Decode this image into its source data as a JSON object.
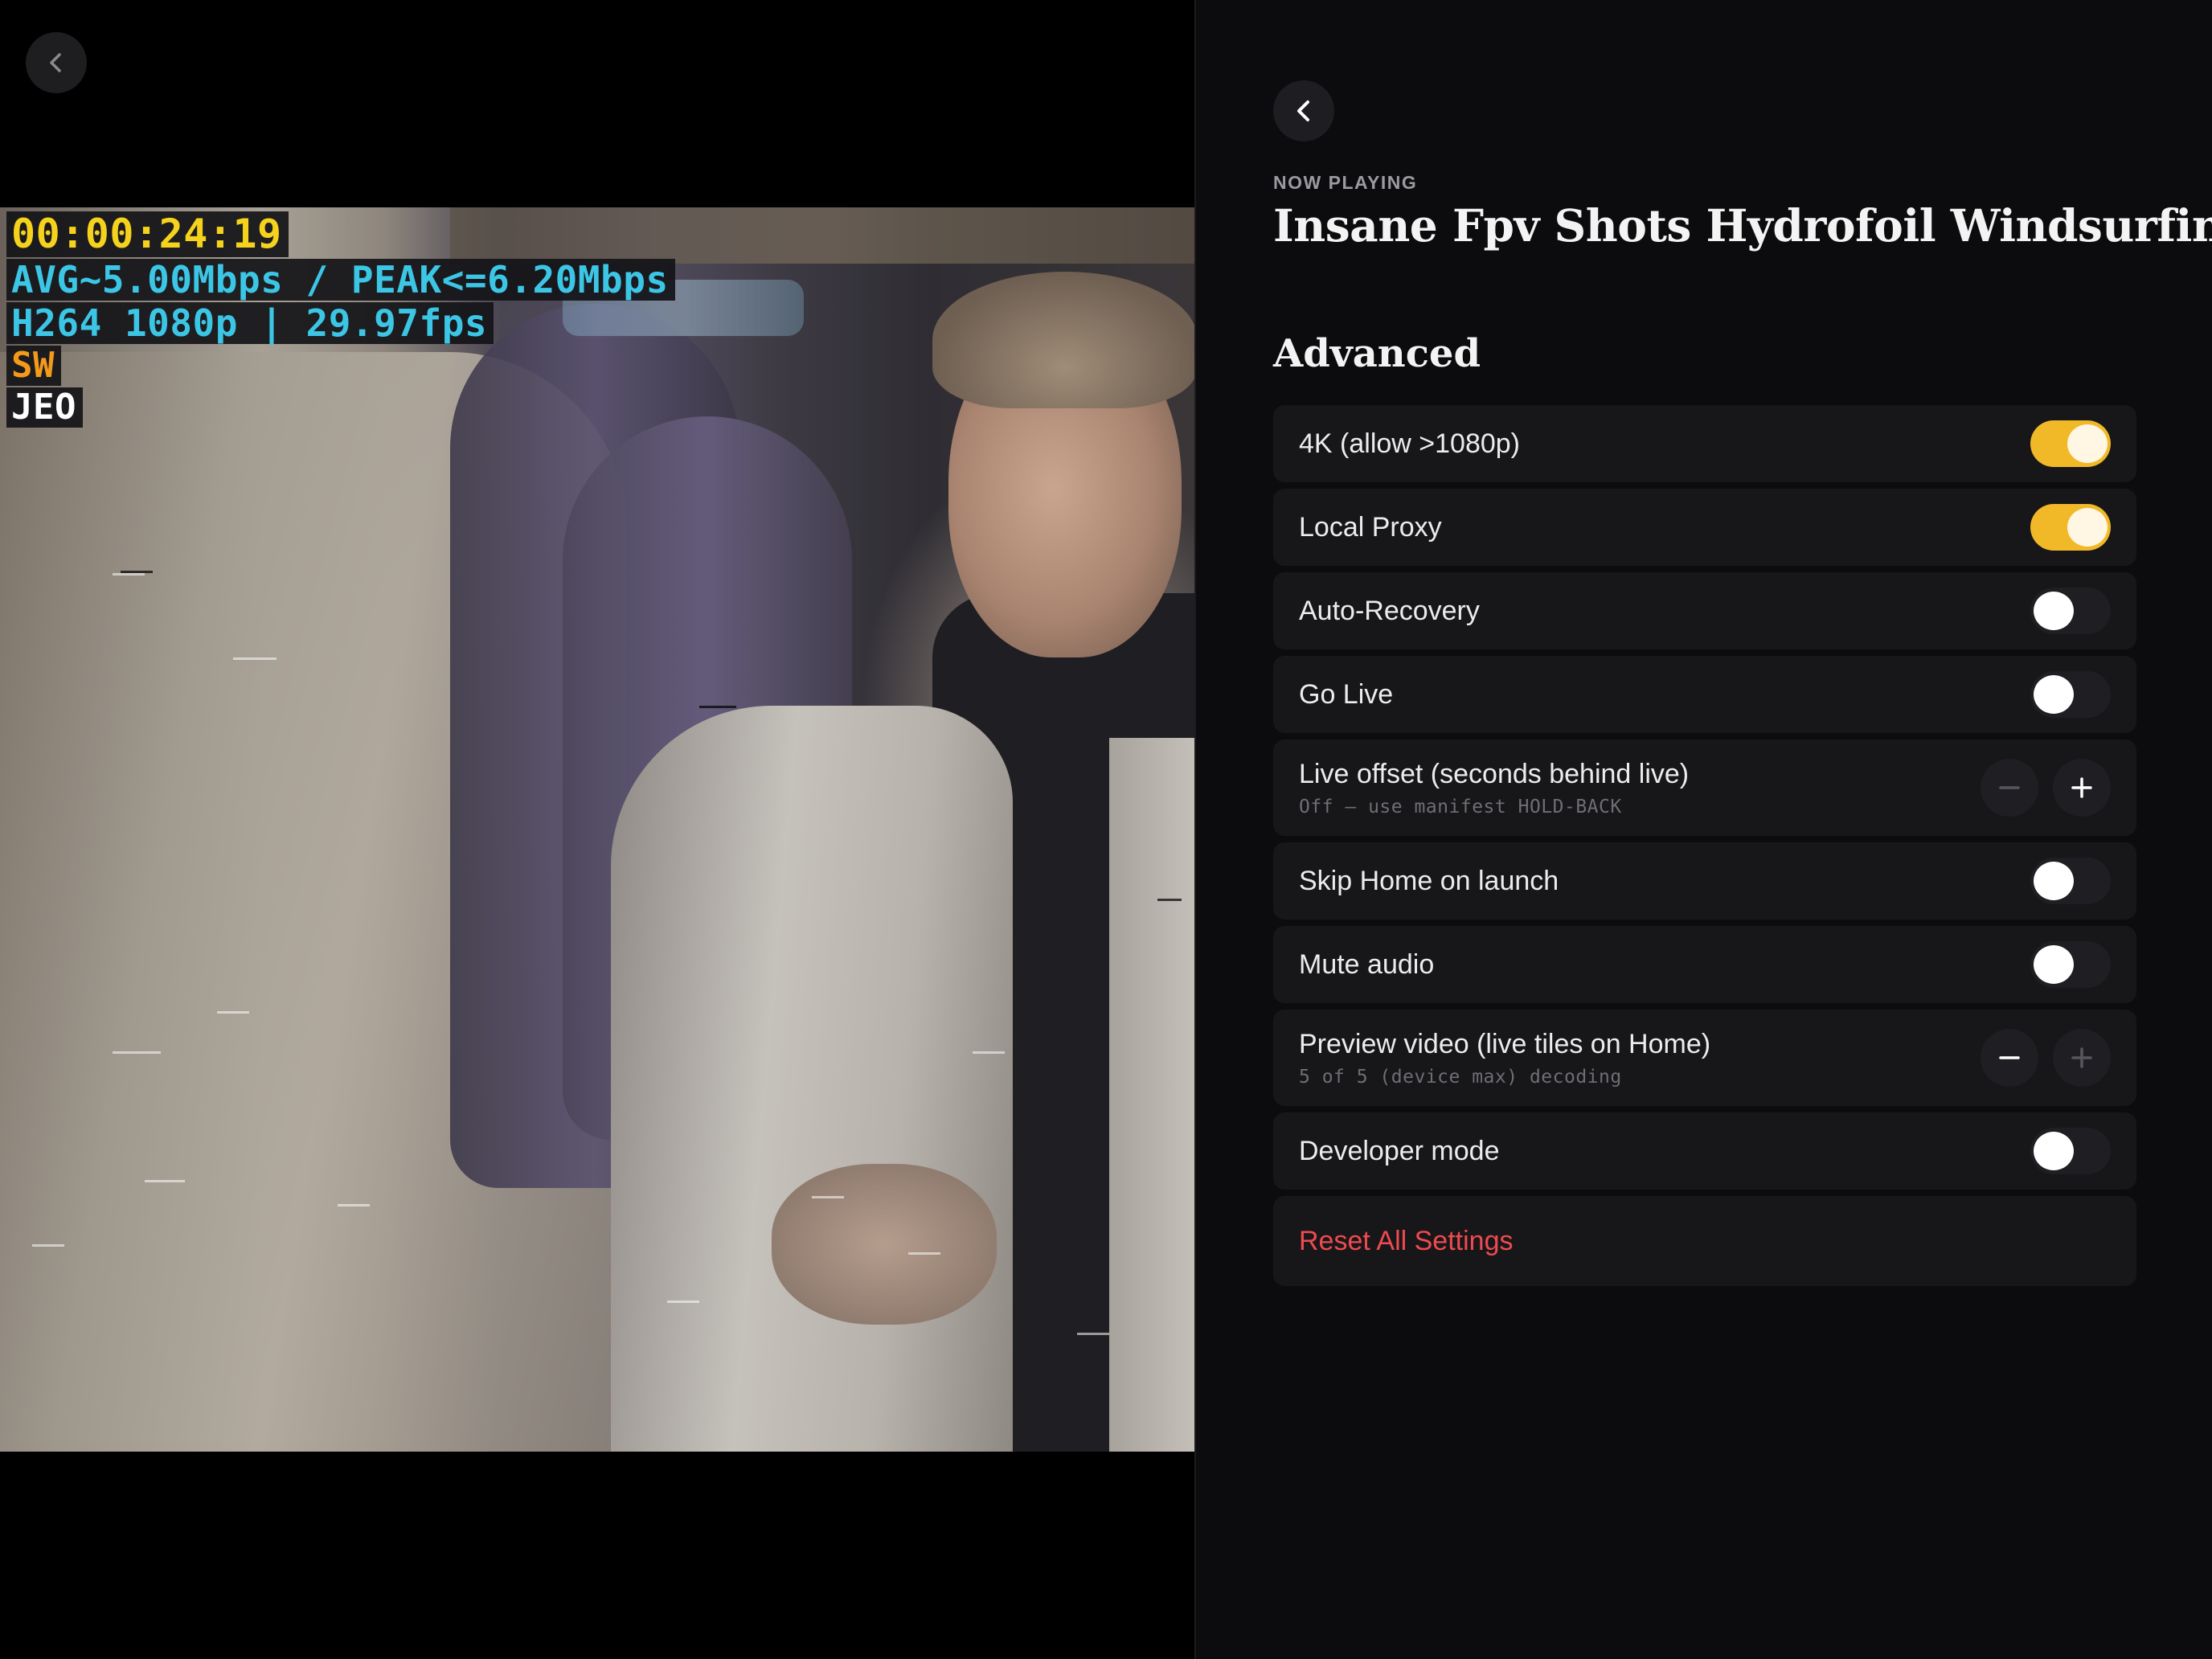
{
  "video": {
    "osd": {
      "timecode": "00:00:24:19",
      "bitrate": "AVG~5.00Mbps / PEAK<=6.20Mbps",
      "codec": "H264 1080p | 29.97fps",
      "decoder": "SW",
      "player": "JEO"
    },
    "osd_colors": {
      "timecode": "#f5d21c",
      "bitrate": "#3cc6e6",
      "codec": "#3cc6e6",
      "decoder": "#f39a1a",
      "player": "#ffffff"
    },
    "back_icon": "chevron-left-icon"
  },
  "settings": {
    "back_icon": "chevron-left-icon",
    "eyebrow": "NOW PLAYING",
    "title": "Insane Fpv Shots Hydrofoil Windsurfing",
    "section": "Advanced",
    "accent": "#f1b928",
    "danger": "#ef4a4f",
    "rows": [
      {
        "label": "4K (allow >1080p)",
        "on": true
      },
      {
        "label": "Local Proxy",
        "on": true
      },
      {
        "label": "Auto-Recovery",
        "on": false
      },
      {
        "label": "Go Live",
        "on": false
      },
      {
        "label": "Live offset (seconds behind live)",
        "sub": "Off — use manifest HOLD-BACK",
        "minus_enabled": false,
        "plus_enabled": true
      },
      {
        "label": "Skip Home on launch",
        "on": false
      },
      {
        "label": "Mute audio",
        "on": false
      },
      {
        "label": "Preview video (live tiles on Home)",
        "sub": "5 of 5 (device max) decoding",
        "minus_enabled": true,
        "plus_enabled": false
      },
      {
        "label": "Developer mode",
        "on": false
      },
      {
        "label": "Reset All Settings"
      }
    ]
  }
}
